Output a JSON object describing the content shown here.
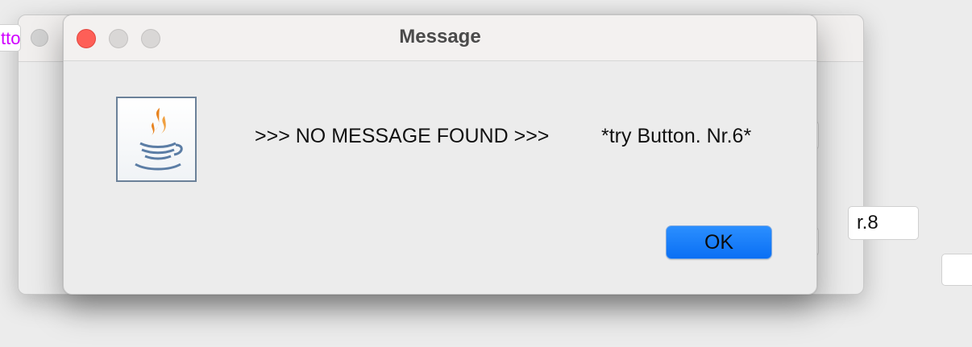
{
  "background": {
    "left_button_fragment": "tto",
    "right_button_fragment": "r.8"
  },
  "dialog": {
    "title": "Message",
    "message": ">>> NO MESSAGE FOUND >>>",
    "hint": "*try Button. Nr.6*",
    "ok_label": "OK",
    "icon": "java-coffee-icon",
    "colors": {
      "close": "#fe5f57",
      "ok_button": "#0a6ff4",
      "icon_flame": "#e8831f",
      "icon_cup": "#5b7da5"
    }
  }
}
